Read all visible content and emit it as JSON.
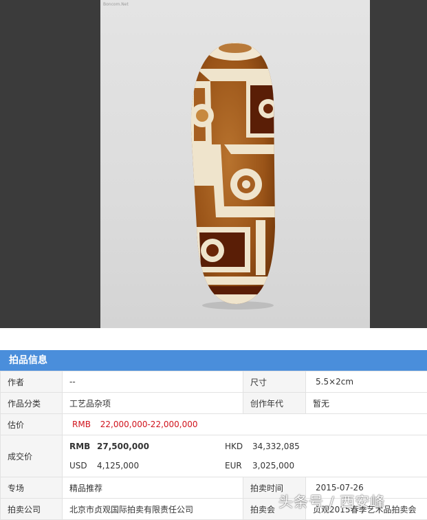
{
  "photo": {
    "watermark": "Boncom.Net",
    "subject": "dzi-bead"
  },
  "panel": {
    "title": "拍品信息",
    "author": {
      "label": "作者",
      "value": "--"
    },
    "size": {
      "label": "尺寸",
      "value": "5.5×2cm"
    },
    "category": {
      "label": "作品分类",
      "value": "工艺品杂项"
    },
    "year": {
      "label": "创作年代",
      "value": "暂无"
    },
    "estimate": {
      "label": "估价",
      "currency": "RMB",
      "value": "22,000,000-22,000,000"
    },
    "deal": {
      "label": "成交价",
      "rmb_cur": "RMB",
      "rmb": "27,500,000",
      "hkd_cur": "HKD",
      "hkd": "34,332,085",
      "usd_cur": "USD",
      "usd": "4,125,000",
      "eur_cur": "EUR",
      "eur": "3,025,000"
    },
    "session": {
      "label": "专场",
      "value": "精品推荐"
    },
    "auction_time": {
      "label": "拍卖时间",
      "value": "2015-07-26"
    },
    "company": {
      "label": "拍卖公司",
      "value": "北京市贞观国际拍卖有限责任公司"
    },
    "auction": {
      "label": "拍卖会",
      "value": "贞观2015春季艺术品拍卖会"
    }
  },
  "overlay_text": "头条号 / 西安峰",
  "colors": {
    "header": "#4a8edb",
    "estimate": "#d0121b"
  }
}
